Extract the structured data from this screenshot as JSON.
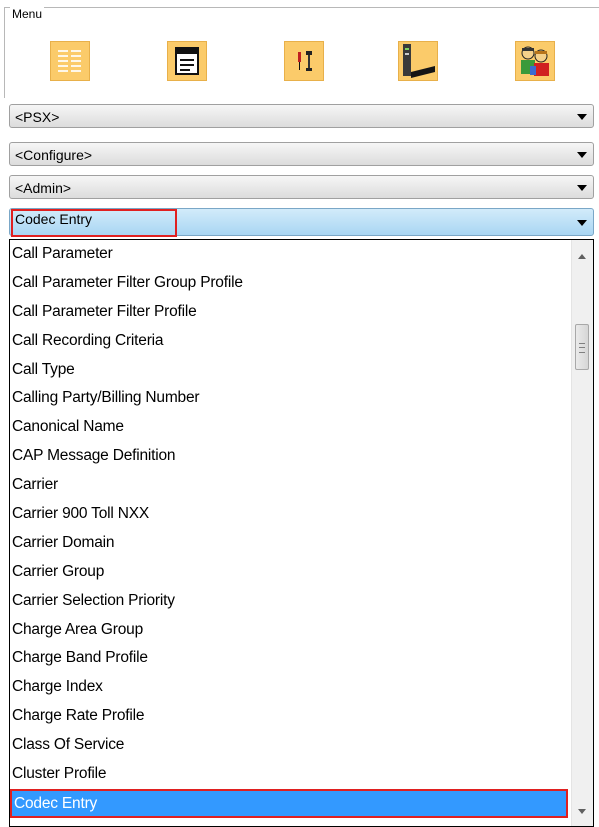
{
  "menu": {
    "legend": "Menu",
    "toolbar_icons": [
      "list-icon",
      "form-window-icon",
      "tools-icon",
      "network-device-icon",
      "users-icon"
    ]
  },
  "combos": [
    {
      "label": "<PSX>"
    },
    {
      "label": "<Configure>"
    },
    {
      "label": "<Admin>"
    },
    {
      "label": "Codec Entry",
      "active": true
    }
  ],
  "dropdown": {
    "items": [
      "Call Parameter",
      "Call Parameter Filter Group Profile",
      "Call Parameter Filter Profile",
      "Call Recording Criteria",
      "Call Type",
      "Calling Party/Billing Number",
      "Canonical Name",
      "CAP Message Definition",
      "Carrier",
      "Carrier 900 Toll NXX",
      "Carrier Domain",
      "Carrier Group",
      "Carrier Selection Priority",
      "Charge Area Group",
      "Charge Band Profile",
      "Charge Index",
      "Charge Rate Profile",
      "Class Of Service",
      "Cluster Profile",
      "Codec Entry"
    ],
    "selected": "Codec Entry"
  },
  "colors": {
    "selection": "#3399ff",
    "highlight_border": "#e02020",
    "icon_background": "#fbcb6a"
  }
}
